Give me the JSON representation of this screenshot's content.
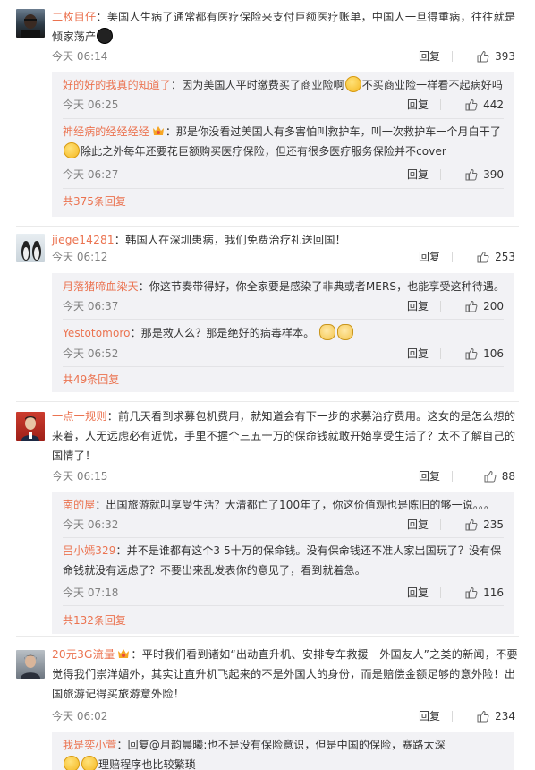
{
  "thumb_icon": "thumbs-up-icon",
  "colors": {
    "username": "#eb7350",
    "sub_bg": "#f2f2f5",
    "meta": "#808080"
  },
  "comments": [
    {
      "username": "二枚目仔",
      "sep": "：",
      "text": "美国人生病了通常都有医疗保险来支付巨额医疗账单，中国人一旦得重病，往往就是倾家荡产",
      "time": "今天 06:14",
      "reply": "回复",
      "likes": "393",
      "replies": [
        {
          "username": "好的好的我真的知道了",
          "text_a": "因为美国人平时缴费买了商业险啊",
          "text_b": "不买商业险一样看不起病好吗",
          "time": "今天 06:25",
          "reply": "回复",
          "likes": "442"
        },
        {
          "username": "神经病的经经经经",
          "text_a": "那是你没看过美国人有多害怕叫救护车，叫一次救护车一个月白干了",
          "text_b": "除此之外每年还要花巨额购买医疗保险，但还有很多医疗服务保险并不cover",
          "time": "今天 06:27",
          "reply": "回复",
          "likes": "390"
        }
      ],
      "more": "共375条回复"
    },
    {
      "username": "jiege14281",
      "sep": "：",
      "text": "韩国人在深圳患病，我们免费治疗礼送回国！",
      "time": "今天 06:12",
      "reply": "回复",
      "likes": "253",
      "replies": [
        {
          "username": "月落猪啼血染天",
          "text_a": "你这节奏带得好，你全家要是感染了非典或者MERS，也能享受这种待遇。",
          "time": "今天 06:37",
          "reply": "回复",
          "likes": "200"
        },
        {
          "username": "Yestotomoro",
          "text_a": "那是救人么？那是绝好的病毒样本。",
          "time": "今天 06:52",
          "reply": "回复",
          "likes": "106"
        }
      ],
      "more": "共49条回复"
    },
    {
      "username": "一点一规则",
      "sep": "：",
      "text": "前几天看到求募包机费用，就知道会有下一步的求募治疗费用。这女的是怎么想的来着，人无远虑必有近忧，手里不握个三五十万的保命钱就敢开始享受生活了？太不了解自己的国情了！",
      "time": "今天 06:15",
      "reply": "回复",
      "likes": "88",
      "replies": [
        {
          "username": "南的屋",
          "text_a": "出国旅游就叫享受生活？大清都亡了100年了，你这价值观也是陈旧的够一说。。。",
          "time": "今天 06:32",
          "reply": "回复",
          "likes": "235"
        },
        {
          "username": "吕小嫣329",
          "text_a": "并不是谁都有这个3 5十万的保命钱。没有保命钱还不准人家出国玩了？没有保命钱就没有远虑了？不要出来乱发表你的意见了，看到就着急。",
          "time": "今天 07:18",
          "reply": "回复",
          "likes": "116"
        }
      ],
      "more": "共132条回复"
    },
    {
      "username": "20元3G流量",
      "sep": "：",
      "text": "平时我们看到诸如“出动直升机、安排专车救援一外国友人”之类的新闻，不要觉得我们崇洋媚外，其实让直升机飞起来的不是外国人的身份，而是赔偿金额足够的意外险！出国旅游记得买旅游意外险！",
      "time": "今天 06:02",
      "reply": "回复",
      "likes": "234",
      "replies": [
        {
          "username": "我是奕小萱",
          "text_a": "回复@月韵晨曦:也不是没有保险意识，但是中国的保险，赛路太深",
          "text_b": "理赔程序也比较繁琐"
        }
      ]
    }
  ]
}
